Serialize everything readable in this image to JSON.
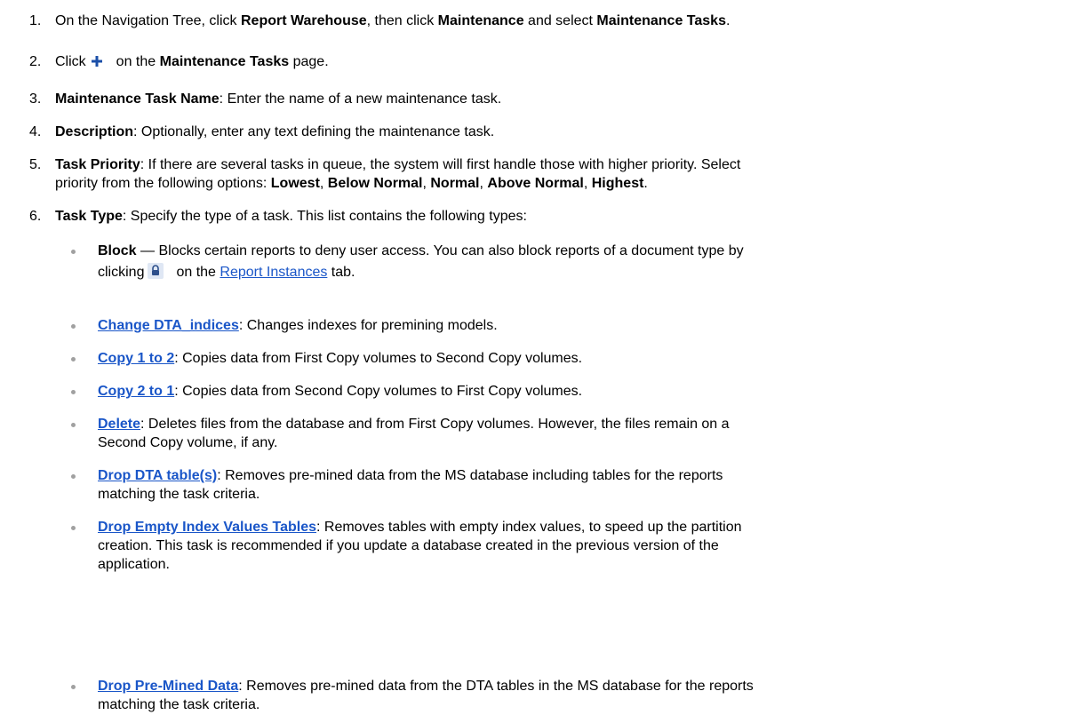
{
  "steps": [
    {
      "number": "1.",
      "parts": [
        "On the Navigation Tree, click ",
        "Report Warehouse",
        ", then click ",
        "Maintenance",
        " and select ",
        "Maintenance Tasks",
        "."
      ]
    },
    {
      "number": "2.",
      "parts": [
        "Click",
        "on the ",
        "Maintenance Tasks",
        " page."
      ],
      "icon": "plus-icon"
    },
    {
      "number": "3.",
      "parts": [
        "Maintenance Task Name",
        ": Enter the name of a new maintenance task."
      ]
    },
    {
      "number": "4.",
      "parts": [
        "Description",
        ": Optionally, enter any text defining the maintenance task."
      ]
    },
    {
      "number": "5.",
      "parts": [
        "Task Priority",
        ": If there are several tasks in queue, the system will first handle those with higher priority. Select",
        "priority from the following options: ",
        "Lowest",
        ", ",
        "Below Normal",
        ", ",
        "Normal",
        ", ",
        "Above Normal",
        ", ",
        "Highest",
        "."
      ]
    },
    {
      "number": "6.",
      "parts": [
        "Task Type",
        ": Specify the type of a task. This list contains the following types:"
      ]
    }
  ],
  "task_types": [
    {
      "term": "Block",
      "parts": [
        " — Blocks certain reports to deny user access. You can also block reports of a document type by",
        "clicking",
        "on the ",
        "Report Instances",
        " tab."
      ],
      "icon": "lock-icon"
    },
    {
      "term": "Change DTA_indices",
      "parts": [
        ": Changes indexes for premining models."
      ]
    },
    {
      "term": "Copy 1 to 2",
      "parts": [
        ": Copies data from First Copy volumes to Second Copy volumes."
      ]
    },
    {
      "term": "Copy 2 to 1",
      "parts": [
        ": Copies data from Second Copy volumes to First Copy volumes."
      ]
    },
    {
      "term": "Delete",
      "parts": [
        ": Deletes files from the database and from First Copy volumes. However, the files remain on a",
        "Second Copy volume, if any."
      ]
    },
    {
      "term": "Drop DTA table(s)",
      "parts": [
        ": Removes pre-mined data from the MS database including tables for the reports",
        "matching the task criteria."
      ]
    },
    {
      "term": "Drop Empty Index Values Tables",
      "parts": [
        ": Removes tables with empty index values, to speed up the partition",
        "creation. This task is recommended if you update a database created in the previous version of the",
        "application."
      ]
    },
    {
      "term": "Drop Pre-Mined Data",
      "parts": [
        ": Removes pre-mined data from the DTA tables in the MS database for the reports",
        "matching the task criteria."
      ]
    }
  ]
}
